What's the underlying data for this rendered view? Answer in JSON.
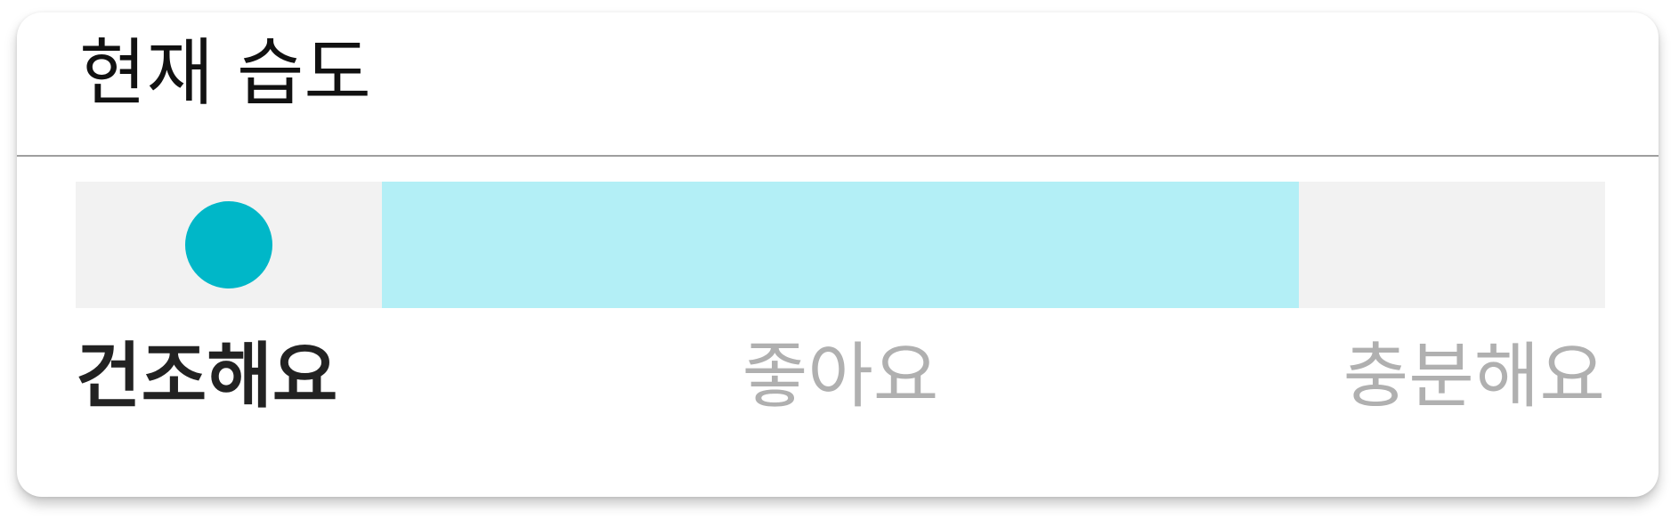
{
  "widget": {
    "title": "현재 습도",
    "current_level_index": 0,
    "current_level_label": "건조해요",
    "colors": {
      "marker": "#00b7c8",
      "active_range": "#b3eff6",
      "inactive_range": "#f2f2f2",
      "selected_label": "#222222",
      "unselected_label": "#b0b0b0",
      "divider": "#9e9e9e"
    },
    "scale": {
      "segments": [
        {
          "state": "inactive",
          "marker": true
        },
        {
          "state": "active",
          "marker": false
        },
        {
          "state": "active",
          "marker": false
        },
        {
          "state": "active",
          "marker": false
        },
        {
          "state": "inactive",
          "marker": false
        }
      ],
      "labels": [
        "건조해요",
        "좋아요",
        "충분해요"
      ]
    }
  }
}
